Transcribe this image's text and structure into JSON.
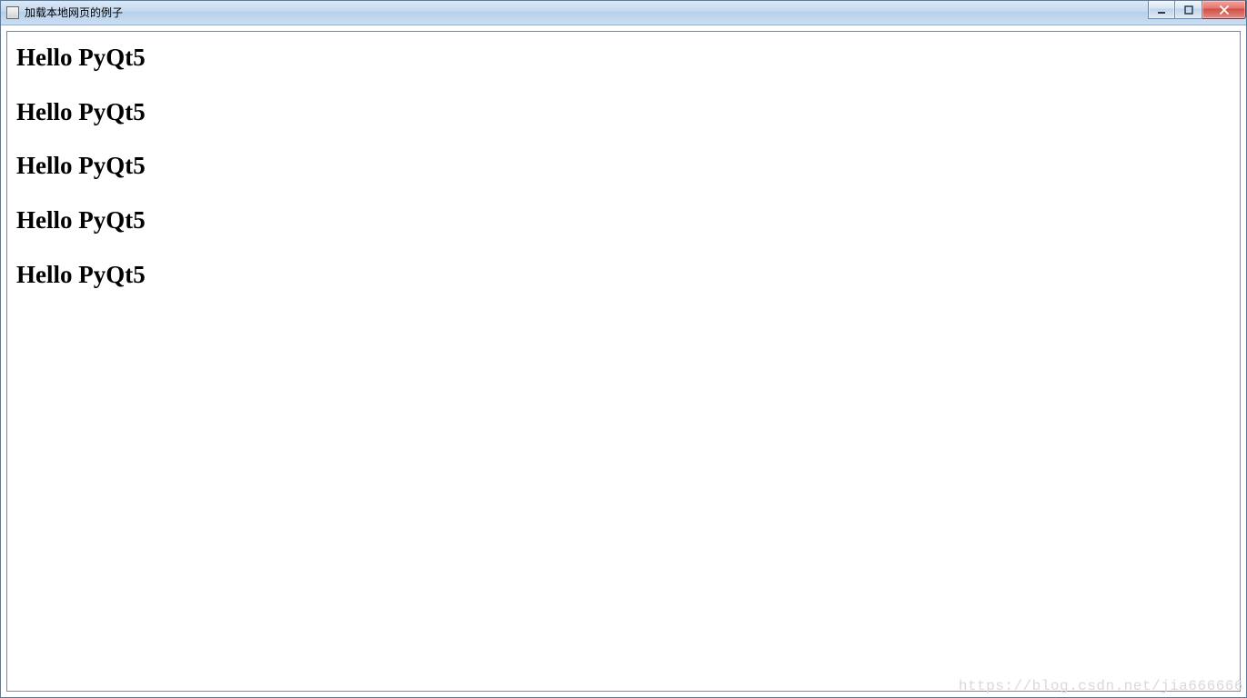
{
  "window": {
    "title": "加载本地网页的例子"
  },
  "content": {
    "headings": [
      "Hello PyQt5",
      "Hello PyQt5",
      "Hello PyQt5",
      "Hello PyQt5",
      "Hello PyQt5"
    ]
  },
  "watermark": "https://blog.csdn.net/jia666666"
}
